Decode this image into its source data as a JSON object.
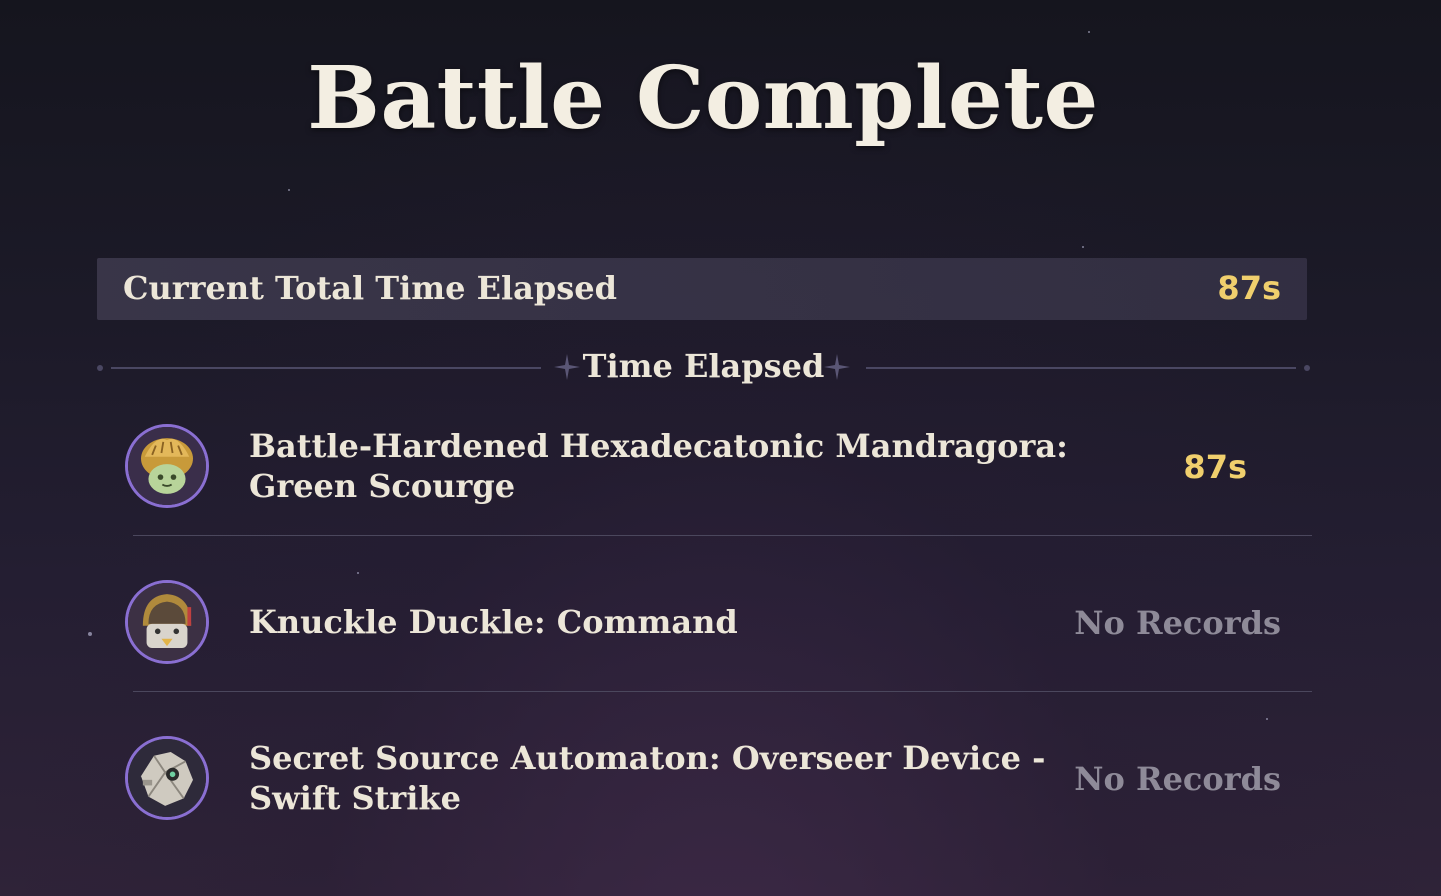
{
  "title": "Battle Complete",
  "total": {
    "label": "Current Total Time Elapsed",
    "value": "87s"
  },
  "section_header": "Time Elapsed",
  "rows": [
    {
      "name": "Battle-Hardened Hexadecatonic Mandragora: Green Scourge",
      "value": "87s",
      "avatar_icon": "mandragora-portrait-icon"
    },
    {
      "name": "Knuckle Duckle: Command",
      "value": "No Records",
      "avatar_icon": "knuckle-duckle-portrait-icon"
    },
    {
      "name": "Secret Source Automaton: Overseer Device - Swift Strike",
      "value": "No Records",
      "avatar_icon": "automaton-portrait-icon"
    }
  ],
  "colors": {
    "accent_gold": "#f0cf6d",
    "muted_gray": "#8e8a98",
    "avatar_border": "#8a6fd2"
  }
}
